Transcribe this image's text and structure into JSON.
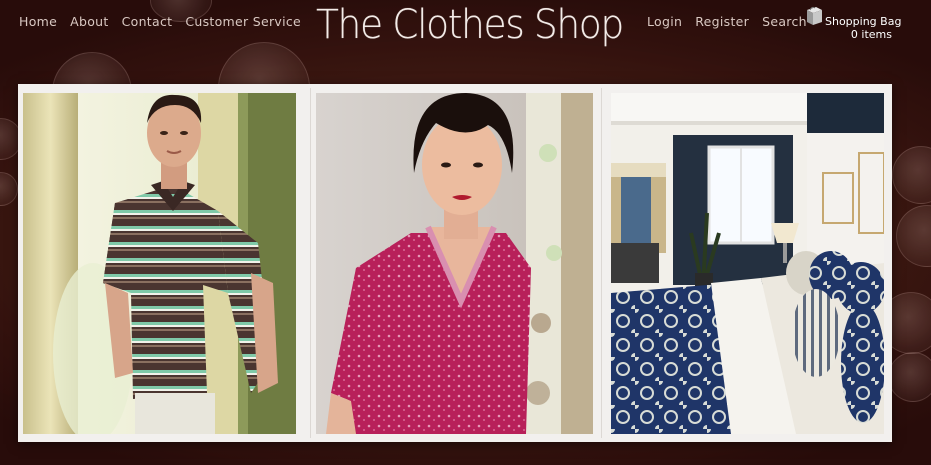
{
  "nav_left": [
    {
      "label": "Home"
    },
    {
      "label": "About"
    },
    {
      "label": "Contact"
    },
    {
      "label": "Customer Service"
    }
  ],
  "logo": "The Clothes Shop",
  "nav_right": [
    {
      "label": "Login"
    },
    {
      "label": "Register"
    },
    {
      "label": "Search"
    }
  ],
  "shopping_bag": {
    "label": "Shopping Bag",
    "count": "0 items",
    "icon": "shopping-bag-icon"
  },
  "gallery": [
    {
      "subject": "man in striped polo shirt",
      "name": "photo-man-striped-polo"
    },
    {
      "subject": "woman in pink patterned top",
      "name": "photo-woman-pink-top"
    },
    {
      "subject": "bedroom with patterned bedding",
      "name": "photo-bedroom-bedding"
    }
  ],
  "colors": {
    "background": "#2a0b08",
    "nav_text": "#d9c8c2",
    "logo_text": "#f4ece8",
    "gallery_frame": "#f2f0ee"
  }
}
